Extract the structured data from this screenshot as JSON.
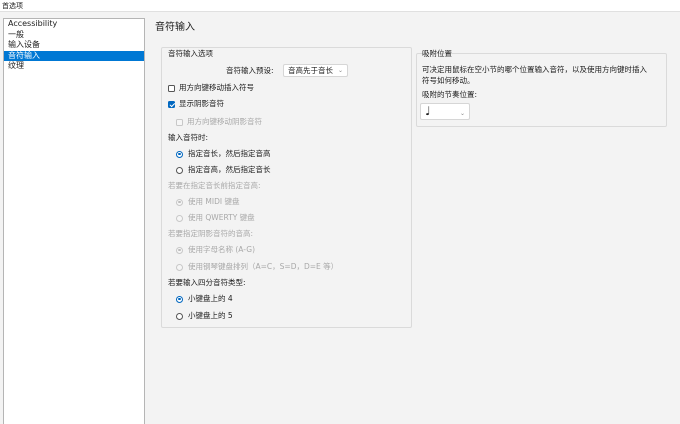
{
  "window": {
    "title": "首选项"
  },
  "sidebar": {
    "items": [
      {
        "label": "Accessibility",
        "selected": false
      },
      {
        "label": "一般",
        "selected": false
      },
      {
        "label": "输入设备",
        "selected": false
      },
      {
        "label": "音符输入",
        "selected": true
      },
      {
        "label": "纹理",
        "selected": false
      }
    ]
  },
  "page": {
    "title": "音符输入"
  },
  "note_input_options": {
    "group_title": "音符输入选项",
    "preset_label": "音符输入预设:",
    "preset_value": "音高先于音长",
    "move_with_arrows": {
      "label": "用方向键移动插入符号",
      "checked": false
    },
    "show_shadow_note": {
      "label": "显示阴影音符",
      "checked": true
    },
    "move_shadow_with_arrows": {
      "label": "用方向键移动阴影音符",
      "checked": false,
      "enabled": false
    },
    "when_entering_heading": "输入音符时:",
    "duration_then_pitch": {
      "label": "指定音长，然后指定音高",
      "selected": true
    },
    "pitch_then_duration": {
      "label": "指定音高，然后指定音长",
      "selected": false
    },
    "specify_pitch_after_duration_heading": "若要在指定音长前指定音高:",
    "use_midi_keyboard": {
      "label": "使用 MIDI 键盘",
      "selected": true
    },
    "use_qwerty_keyboard": {
      "label": "使用 QWERTY 键盘",
      "selected": false
    },
    "shadow_pitch_heading": "若要指定阴影音符的音高:",
    "use_letter_names": {
      "label": "使用字母名称 (A-G)",
      "selected": true
    },
    "use_piano_layout": {
      "label": "使用钢琴键盘排列（A=C，S=D，D=E 等）",
      "selected": false
    },
    "quarter_note_heading": "若要输入四分音符类型:",
    "key_4": {
      "label": "小键盘上的 4",
      "selected": true
    },
    "key_5": {
      "label": "小键盘上的 5",
      "selected": false
    }
  },
  "snap_position": {
    "group_title": "吸附位置",
    "description_line1": "可决定用鼠标在空小节的哪个位置输入音符，以及使用方向键时插入",
    "description_line2": "符号如何移动。",
    "rhythm_label": "吸附的节奏位置:",
    "rhythm_value": "♩"
  },
  "colors": {
    "accent": "#0067c0",
    "selection": "#0078d4"
  }
}
